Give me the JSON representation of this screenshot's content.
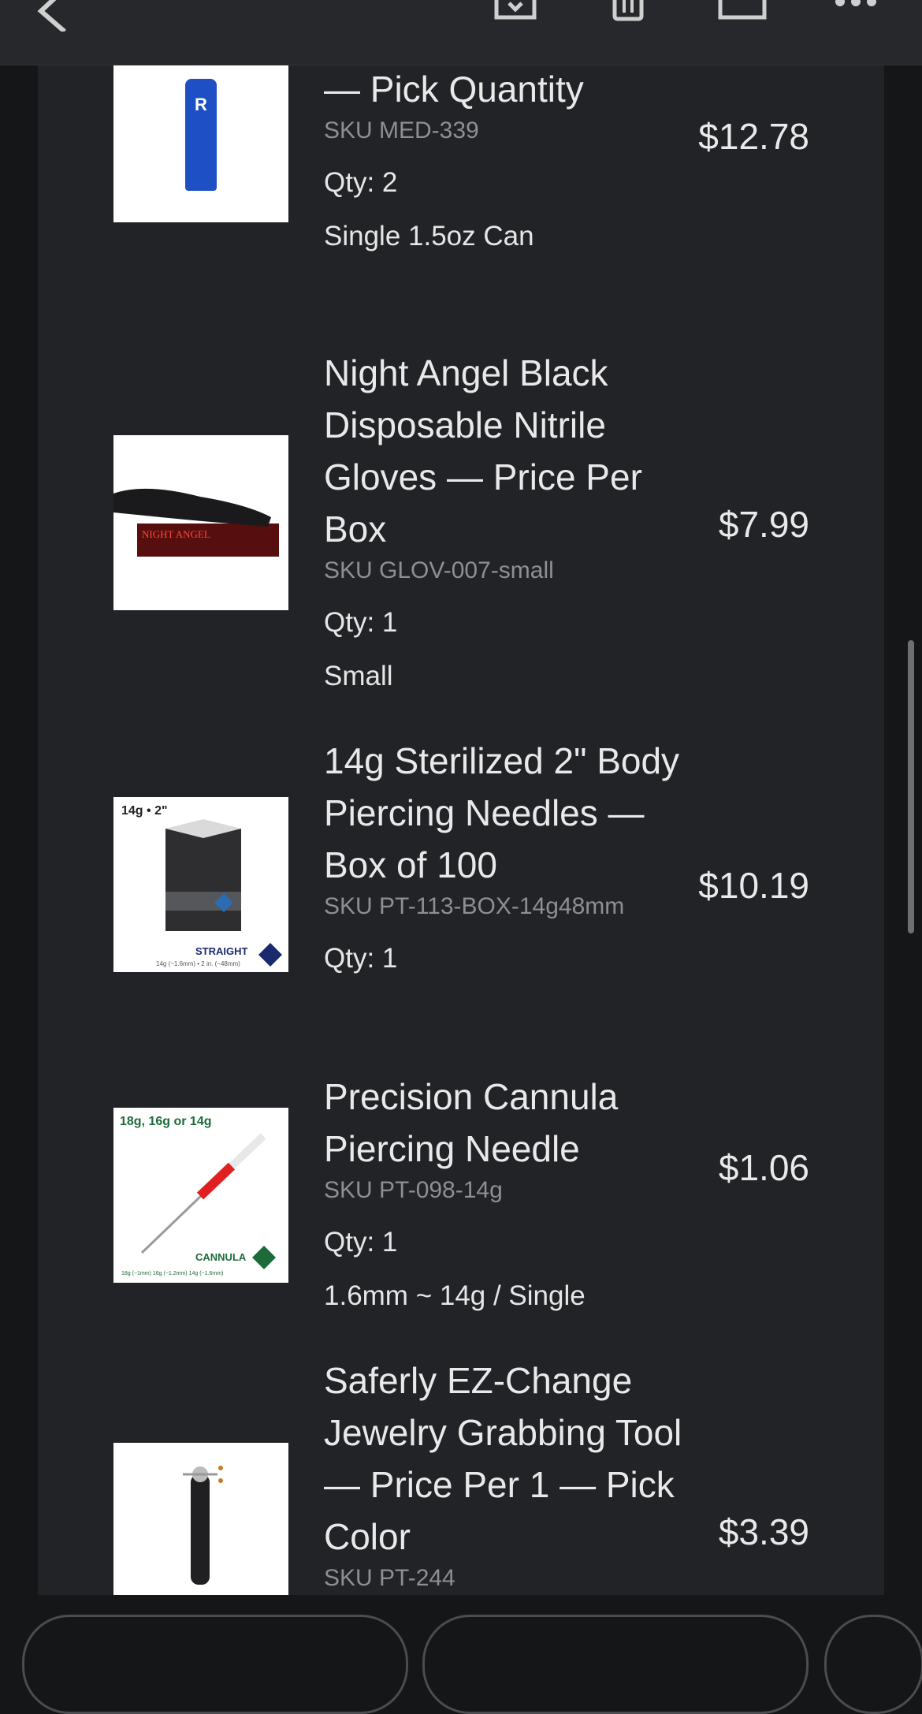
{
  "toolbar": {
    "icons": [
      "back-arrow-icon",
      "download-icon",
      "trash-icon",
      "edit-icon",
      "more-icon"
    ]
  },
  "items": [
    {
      "title": "Saline Wash Solution — Pick Quantity",
      "sku": "SKU MED-339",
      "qty": "Qty: 2",
      "variant": "Single 1.5oz Can",
      "price": "$12.78",
      "image_text": "PURIFIED SALINE WASH"
    },
    {
      "title": "Night Angel Black Disposable Nitrile Gloves — Price Per Box",
      "sku": "SKU GLOV-007-small",
      "qty": "Qty: 1",
      "variant": "Small",
      "price": "$7.99",
      "image_text": "NIGHT ANGEL"
    },
    {
      "title": "14g Sterilized 2\" Body Piercing Needles — Box of 100",
      "sku": "SKU PT-113-BOX-14g48mm",
      "qty": "Qty: 1",
      "variant": "",
      "price": "$10.19",
      "image_text": "14g • 2\"",
      "image_text2": "STRAIGHT",
      "image_text3": "14g (~1.6mm) • 2 in. (~48mm)"
    },
    {
      "title": "Precision Cannula Piercing Needle",
      "sku": "SKU PT-098-14g",
      "qty": "Qty: 1",
      "variant": "1.6mm ~ 14g / Single",
      "price": "$1.06",
      "image_text": "18g, 16g or 14g",
      "image_text2": "CANNULA",
      "image_text3": "18g (~1mm) 16g (~1.2mm) 14g (~1.6mm)"
    },
    {
      "title": "Saferly EZ-Change Jewelry Grabbing Tool — Price Per 1 — Pick Color",
      "sku": "SKU PT-244",
      "qty": "",
      "variant": "",
      "price": "$3.39"
    }
  ],
  "colors": {
    "background": "#151618",
    "card": "#222326",
    "toolbar": "#26282b",
    "text": "#e9e9e9",
    "muted": "#8d8f93"
  }
}
